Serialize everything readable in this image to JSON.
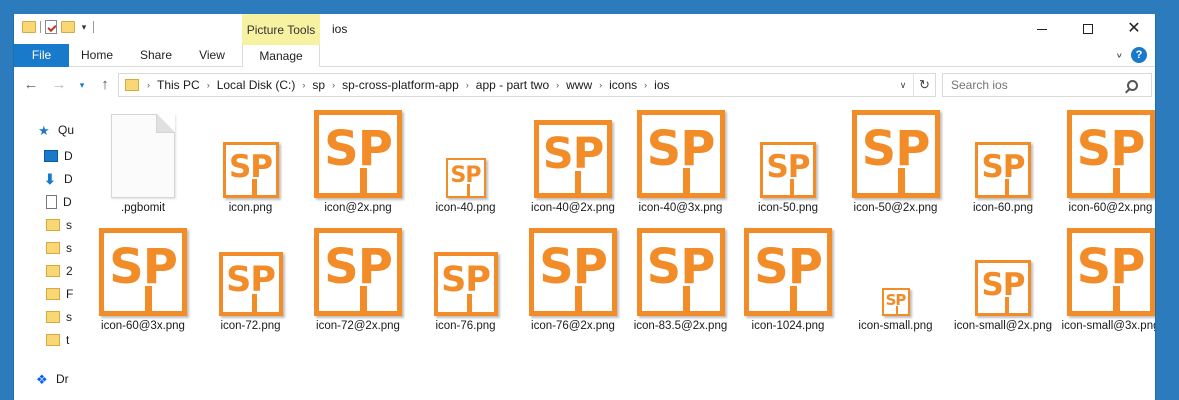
{
  "window": {
    "title": "ios",
    "context_tab_group": "Picture Tools"
  },
  "ribbon": {
    "tabs": {
      "file": "File",
      "home": "Home",
      "share": "Share",
      "view": "View",
      "manage": "Manage"
    },
    "help": "?"
  },
  "address": {
    "crumbs": [
      "This PC",
      "Local Disk (C:)",
      "sp",
      "sp-cross-platform-app",
      "app - part two",
      "www",
      "icons",
      "ios"
    ]
  },
  "search": {
    "placeholder": "Search ios"
  },
  "sidebar": {
    "items": [
      {
        "label": "Qu",
        "icon": "quick-access-star-icon"
      },
      {
        "label": "D",
        "icon": "desktop-icon"
      },
      {
        "label": "D",
        "icon": "downloads-icon"
      },
      {
        "label": "D",
        "icon": "documents-icon"
      },
      {
        "label": "s",
        "icon": "folder-icon"
      },
      {
        "label": "s",
        "icon": "folder-icon"
      },
      {
        "label": "2",
        "icon": "folder-icon"
      },
      {
        "label": "F",
        "icon": "folder-icon"
      },
      {
        "label": "s",
        "icon": "folder-icon"
      },
      {
        "label": "t",
        "icon": "folder-icon"
      },
      {
        "label": "Dr",
        "icon": "dropbox-icon"
      }
    ]
  },
  "icon_text": "SP",
  "colors": {
    "accent": "#1979ca",
    "sp_orange": "#f28c28",
    "picture_tools": "#f7f2a2",
    "desktop_bg": "#2b7bbd"
  },
  "files": [
    {
      "name": ".pgbomit",
      "kind": "blank"
    },
    {
      "name": "icon.png",
      "kind": "sp",
      "scale": "small"
    },
    {
      "name": "icon@2x.png",
      "kind": "sp",
      "scale": "large"
    },
    {
      "name": "icon-40.png",
      "kind": "sp",
      "scale": "xsmall"
    },
    {
      "name": "icon-40@2x.png",
      "kind": "sp",
      "scale": "medium"
    },
    {
      "name": "icon-40@3x.png",
      "kind": "sp",
      "scale": "large"
    },
    {
      "name": "icon-50.png",
      "kind": "sp",
      "scale": "small"
    },
    {
      "name": "icon-50@2x.png",
      "kind": "sp",
      "scale": "large"
    },
    {
      "name": "icon-60.png",
      "kind": "sp",
      "scale": "small"
    },
    {
      "name": "icon-60@2x.png",
      "kind": "sp",
      "scale": "large"
    },
    {
      "name": "icon-60@3x.png",
      "kind": "sp",
      "scale": "large"
    },
    {
      "name": "icon-72.png",
      "kind": "sp",
      "scale": "medium-small"
    },
    {
      "name": "icon-72@2x.png",
      "kind": "sp",
      "scale": "large"
    },
    {
      "name": "icon-76.png",
      "kind": "sp",
      "scale": "medium-small"
    },
    {
      "name": "icon-76@2x.png",
      "kind": "sp",
      "scale": "large"
    },
    {
      "name": "icon-83.5@2x.png",
      "kind": "sp",
      "scale": "large"
    },
    {
      "name": "icon-1024.png",
      "kind": "sp",
      "scale": "large"
    },
    {
      "name": "icon-small.png",
      "kind": "sp",
      "scale": "tiny"
    },
    {
      "name": "icon-small@2x.png",
      "kind": "sp",
      "scale": "small"
    },
    {
      "name": "icon-small@3x.png",
      "kind": "sp",
      "scale": "large"
    }
  ]
}
